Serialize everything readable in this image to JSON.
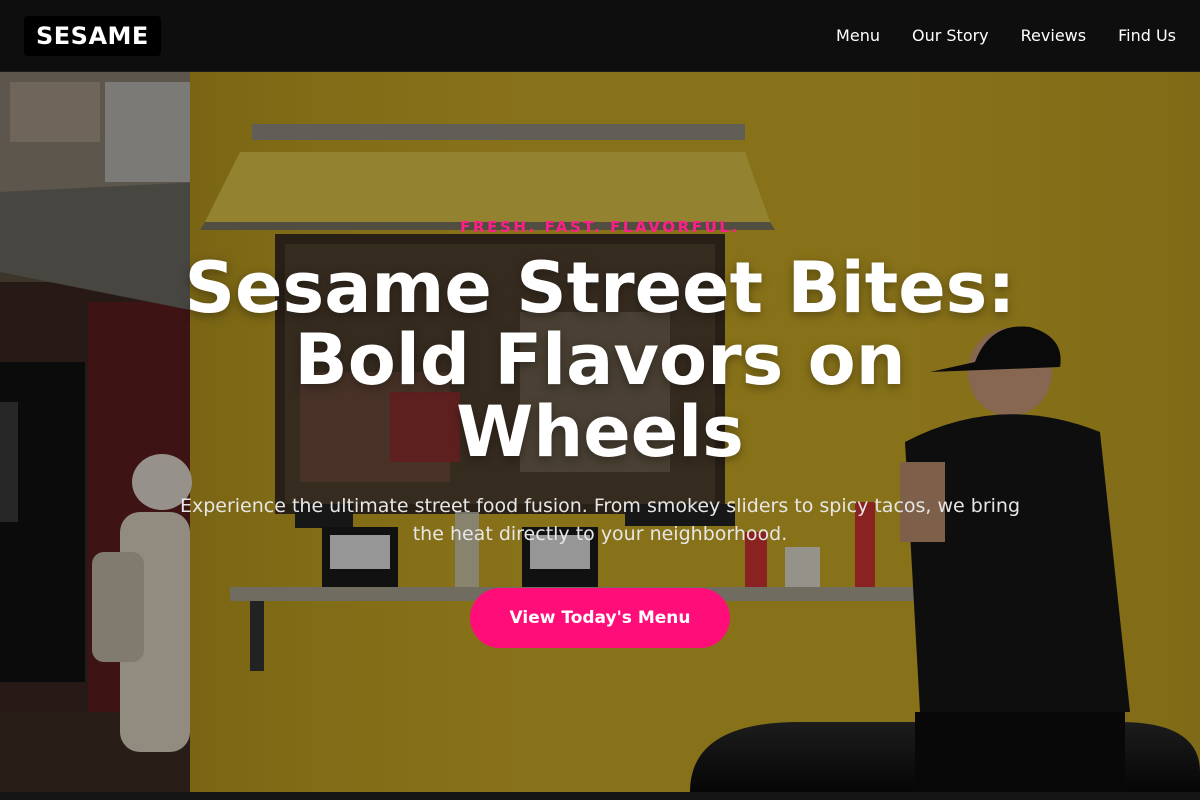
{
  "brand": {
    "logo_text": "SESAME"
  },
  "nav": {
    "items": [
      {
        "label": "Menu"
      },
      {
        "label": "Our Story"
      },
      {
        "label": "Reviews"
      },
      {
        "label": "Find Us"
      }
    ]
  },
  "hero": {
    "eyebrow": "FRESH. FAST. FLAVORFUL.",
    "headline": "Sesame Street Bites: Bold Flavors on Wheels",
    "subtext": "Experience the ultimate street food fusion. From smokey sliders to spicy tacos, we bring the heat directly to your neighborhood.",
    "cta_label": "View Today's Menu",
    "background_image": "food-truck-photo"
  },
  "colors": {
    "accent": "#ff0d78",
    "eyebrow": "#ff1f86",
    "header_bg": "#0e0e0e",
    "truck_yellow": "#c9a825"
  }
}
